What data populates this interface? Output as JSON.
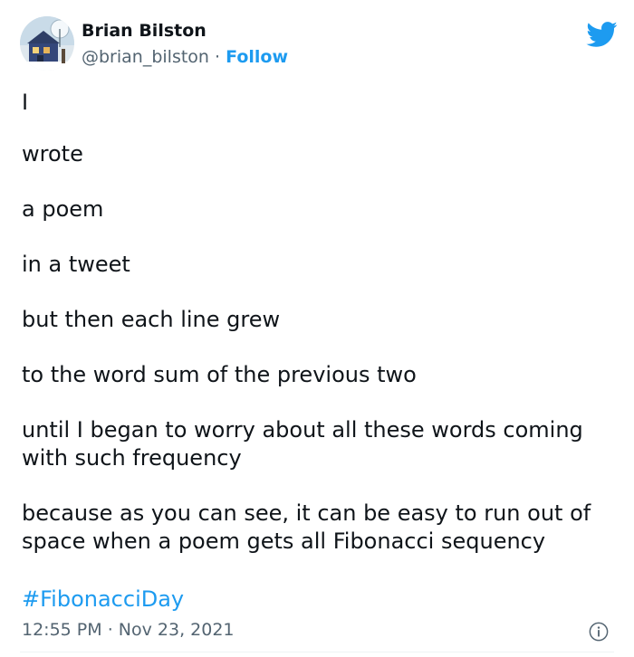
{
  "author": {
    "name": "Brian Bilston",
    "handle": "@brian_bilston",
    "separator": " · ",
    "follow_label": "Follow"
  },
  "poem": {
    "lines": [
      "I",
      "wrote",
      "a poem",
      "in a tweet",
      "but then each line grew",
      "to the word sum of the previous two",
      "until I began to worry about all these words coming with such frequency",
      "because as you can see, it can be easy to run out of space when a poem gets all Fibonacci sequency"
    ]
  },
  "hashtag": "#FibonacciDay",
  "footer": {
    "time": "12:55 PM",
    "separator": " · ",
    "date": "Nov 23, 2021"
  },
  "colors": {
    "accent": "#1d9bf0",
    "text": "#0f1419",
    "muted": "#536471"
  },
  "icons": {
    "brand": "twitter-bird-icon",
    "info": "info-icon"
  }
}
